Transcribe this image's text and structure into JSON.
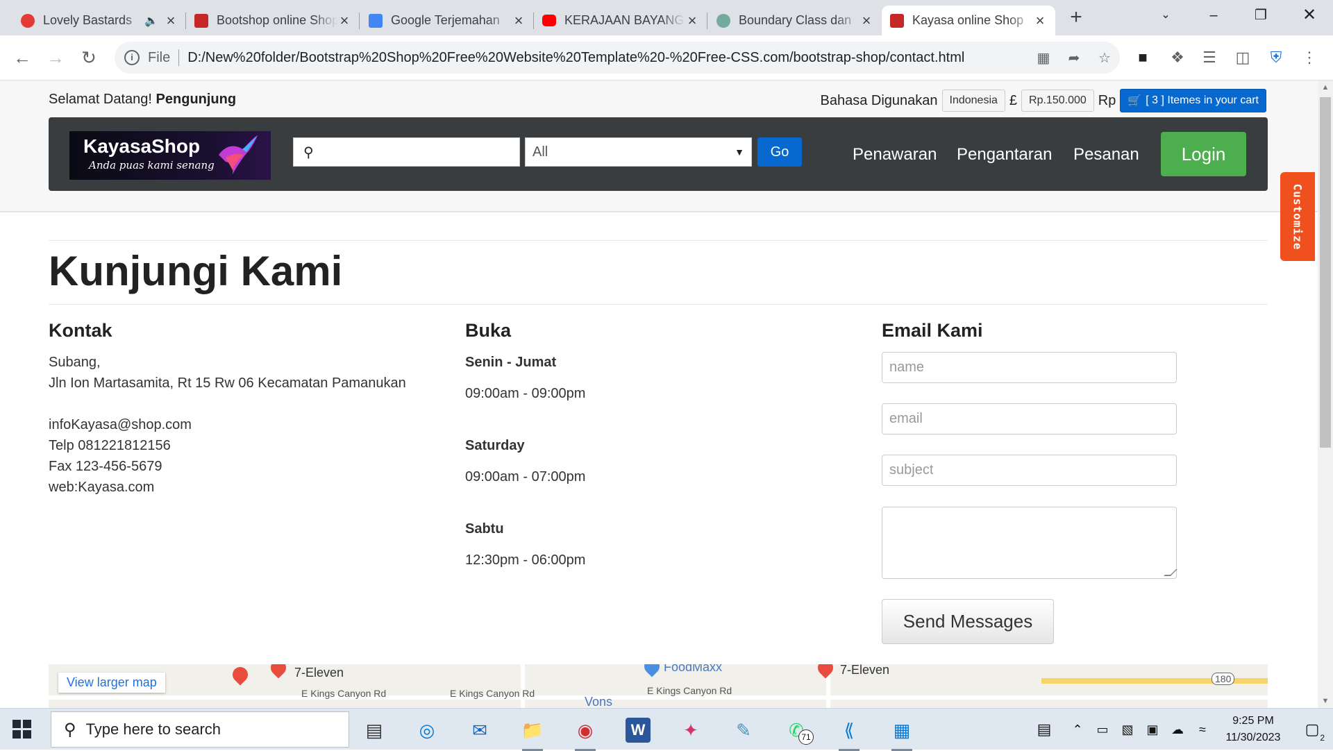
{
  "browser": {
    "tabs": [
      {
        "title": "Lovely Bastards",
        "favicon_color": "#e53935",
        "has_audio": true
      },
      {
        "title": "Bootshop online Shop",
        "favicon_color": "#c62828"
      },
      {
        "title": "Google Terjemahan",
        "favicon_color": "#4285f4"
      },
      {
        "title": "KERAJAAN BAYANGAN",
        "favicon_color": "#ff0000"
      },
      {
        "title": "Boundary Class dan",
        "favicon_color": "#74aa9c"
      },
      {
        "title": "Kayasa online Shop",
        "favicon_color": "#c62828",
        "active": true
      }
    ],
    "url_scheme": "File",
    "url": "D:/New%20folder/Bootstrap%20Shop%20Free%20Website%20Template%20-%20Free-CSS.com/bootstrap-shop/contact.html"
  },
  "page": {
    "welcome_prefix": "Selamat Datang!",
    "welcome_user": "Pengunjung",
    "language_label": "Bahasa Digunakan",
    "language_value": "Indonesia",
    "pound_symbol": "£",
    "price_value": "Rp.150.000",
    "currency_symbol": "Rp",
    "cart_label": "[ 3 ] Itemes in your cart",
    "logo_name": "KayasaShop",
    "logo_tagline": "Anda puas kami senang",
    "search_placeholder": "",
    "category_selected": "All",
    "go_label": "Go",
    "nav_links": [
      "Penawaran",
      "Pengantaran",
      "Pesanan"
    ],
    "login_label": "Login",
    "customize_label": "Customize",
    "heading": "Kunjungi Kami",
    "contact": {
      "title": "Kontak",
      "city": "Subang,",
      "address": "Jln Ion Martasamita, Rt 15 Rw 06 Kecamatan Pamanukan",
      "email": "infoKayasa@shop.com",
      "phone": "Telp 081221812156",
      "fax": "Fax 123-456-5679",
      "web": "web:Kayasa.com"
    },
    "hours": {
      "title": "Buka",
      "blocks": [
        {
          "day": "Senin - Jumat",
          "time": "09:00am - 09:00pm"
        },
        {
          "day": "Saturday",
          "time": "09:00am - 07:00pm"
        },
        {
          "day": "Sabtu",
          "time": "12:30pm - 06:00pm"
        }
      ]
    },
    "email_form": {
      "title": "Email Kami",
      "name_placeholder": "name",
      "email_placeholder": "email",
      "subject_placeholder": "subject",
      "send_label": "Send Messages"
    },
    "map": {
      "larger_map_label": "View larger map",
      "labels": [
        "7-Eleven",
        "E Kings Canyon Rd",
        "E Kings Canyon Rd",
        "FoodMaxx",
        "Vons",
        "E Kings Canyon Rd",
        "7-Eleven",
        "180"
      ]
    }
  },
  "taskbar": {
    "search_placeholder": "Type here to search",
    "time": "9:25 PM",
    "date": "11/30/2023",
    "whatsapp_badge": "71",
    "notification_count": "2"
  }
}
